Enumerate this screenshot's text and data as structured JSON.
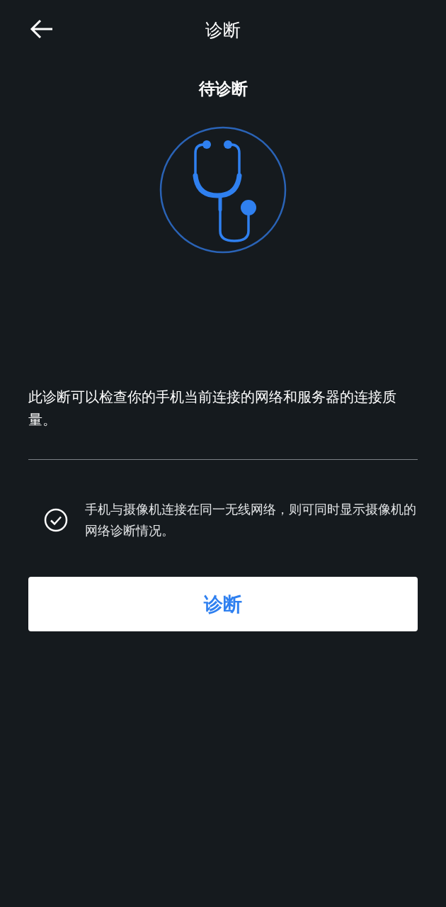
{
  "header": {
    "title": "诊断"
  },
  "status": {
    "label": "待诊断"
  },
  "description": "此诊断可以检查你的手机当前连接的网络和服务器的连接质量。",
  "option": {
    "text": "手机与摄像机连接在同一无线网络，则可同时显示摄像机的网络诊断情况。",
    "checked": true
  },
  "button": {
    "label": "诊断"
  }
}
